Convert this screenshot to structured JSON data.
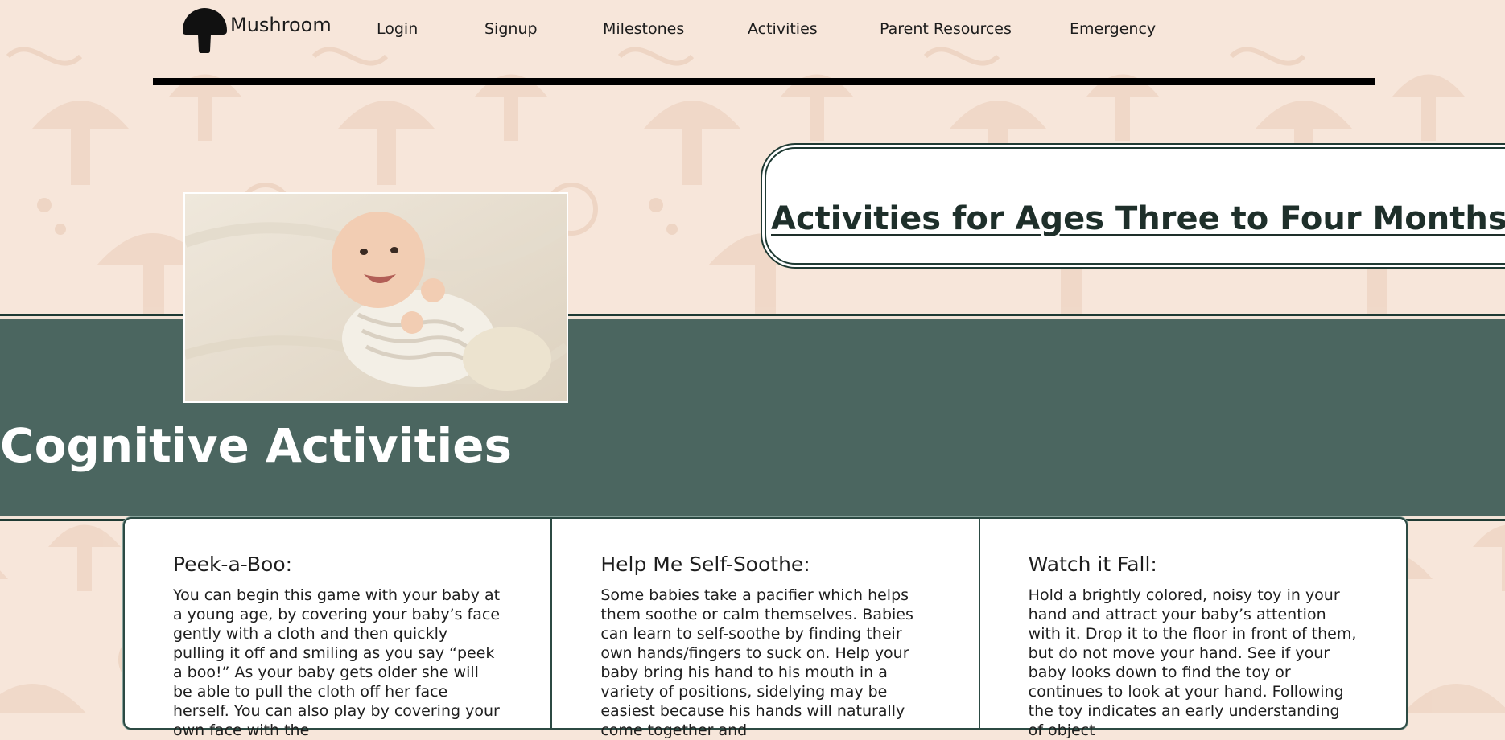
{
  "brand": {
    "name": "Mushroom"
  },
  "nav": {
    "items": [
      "Login",
      "Signup",
      "Milestones",
      "Activities",
      "Parent Resources",
      "Emergency"
    ]
  },
  "hero": {
    "title": "Activities for Ages Three to Four Months"
  },
  "section": {
    "title": "Cognitive Activities"
  },
  "cards": [
    {
      "title": "Peek-a-Boo:",
      "body": "You can begin this game with your baby at a young age, by covering your baby’s face gently with a cloth and then quickly pulling it off and smiling as you say “peek a boo!” As your baby gets older she will be able to pull the cloth off her face herself. You can also play by covering your own face with the"
    },
    {
      "title": "Help Me Self-Soothe:",
      "body": "Some babies take a pacifier which helps them soothe or calm themselves. Babies can learn to self-soothe by finding their own hands/fingers to suck on. Help your baby bring his hand to his mouth in a variety of positions, sidelying may be easiest because his hands will naturally come together and"
    },
    {
      "title": "Watch it Fall:",
      "body": "Hold a brightly colored, noisy toy in your hand and attract your baby’s attention with it. Drop it to the floor in front of them, but do not move your hand. See if your baby looks down to find the toy or continues to look at your hand. Following the toy indicates an early understanding of object"
    }
  ],
  "colors": {
    "background": "#f7e6da",
    "pattern": "#efd8c8",
    "band": "#4b6660",
    "border": "#1f3a33",
    "text": "#1e1e1e"
  },
  "icons": {
    "logo": "mushroom-icon"
  }
}
